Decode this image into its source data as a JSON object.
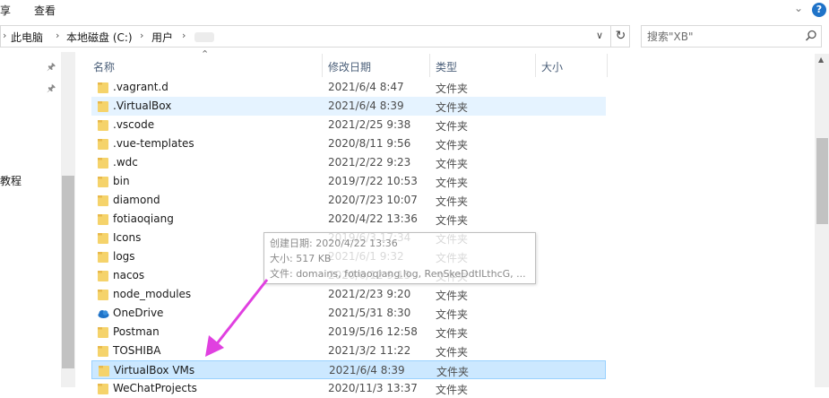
{
  "ribbon": {
    "tabs": [
      "享",
      "查看"
    ]
  },
  "address": {
    "crumbs": [
      "此电脑",
      "本地磁盘 (C:)",
      "用户"
    ]
  },
  "search": {
    "placeholder": "搜索\"XB\""
  },
  "navpane": {
    "partial_label": "教程"
  },
  "columns": [
    "名称",
    "修改日期",
    "类型",
    "大小"
  ],
  "rows": [
    {
      "name": ".vagrant.d",
      "date": "2021/6/4 8:47",
      "type": "文件夹"
    },
    {
      "name": ".VirtualBox",
      "date": "2021/6/4 8:39",
      "type": "文件夹"
    },
    {
      "name": ".vscode",
      "date": "2021/2/25 9:38",
      "type": "文件夹"
    },
    {
      "name": ".vue-templates",
      "date": "2020/8/11 9:56",
      "type": "文件夹"
    },
    {
      "name": ".wdc",
      "date": "2021/2/22 9:23",
      "type": "文件夹"
    },
    {
      "name": "bin",
      "date": "2019/7/22 10:53",
      "type": "文件夹"
    },
    {
      "name": "diamond",
      "date": "2020/7/23 10:07",
      "type": "文件夹"
    },
    {
      "name": "fotiaoqiang",
      "date": "2020/4/22 13:36",
      "type": "文件夹"
    },
    {
      "name": "Icons",
      "date": "2019/6/3 17:34",
      "type": "文件夹"
    },
    {
      "name": "logs",
      "date": "2021/6/1 9:32",
      "type": "文件夹"
    },
    {
      "name": "nacos",
      "date": "2020/6/12 9:15",
      "type": "文件夹"
    },
    {
      "name": "node_modules",
      "date": "2021/2/23 9:20",
      "type": "文件夹"
    },
    {
      "name": "OneDrive",
      "date": "2021/5/31 8:30",
      "type": "文件夹"
    },
    {
      "name": "Postman",
      "date": "2019/5/16 12:58",
      "type": "文件夹"
    },
    {
      "name": "TOSHIBA",
      "date": "2021/3/2 11:22",
      "type": "文件夹"
    },
    {
      "name": "VirtualBox VMs",
      "date": "2021/6/4 8:39",
      "type": "文件夹"
    },
    {
      "name": "WeChatProjects",
      "date": "2020/11/3 13:37",
      "type": "文件夹"
    }
  ],
  "tooltip": {
    "line1": "创建日期: 2020/4/22 13:36",
    "line2": "大小: 517 KB",
    "line3": "文件: domains, fotiaoqiang.log, RenSkeDdtILthcG, ..."
  },
  "colors": {
    "selected": "#cce8ff",
    "hover": "#e5f3ff",
    "arrow": "#e040e0",
    "folder": "#f5d36b"
  }
}
